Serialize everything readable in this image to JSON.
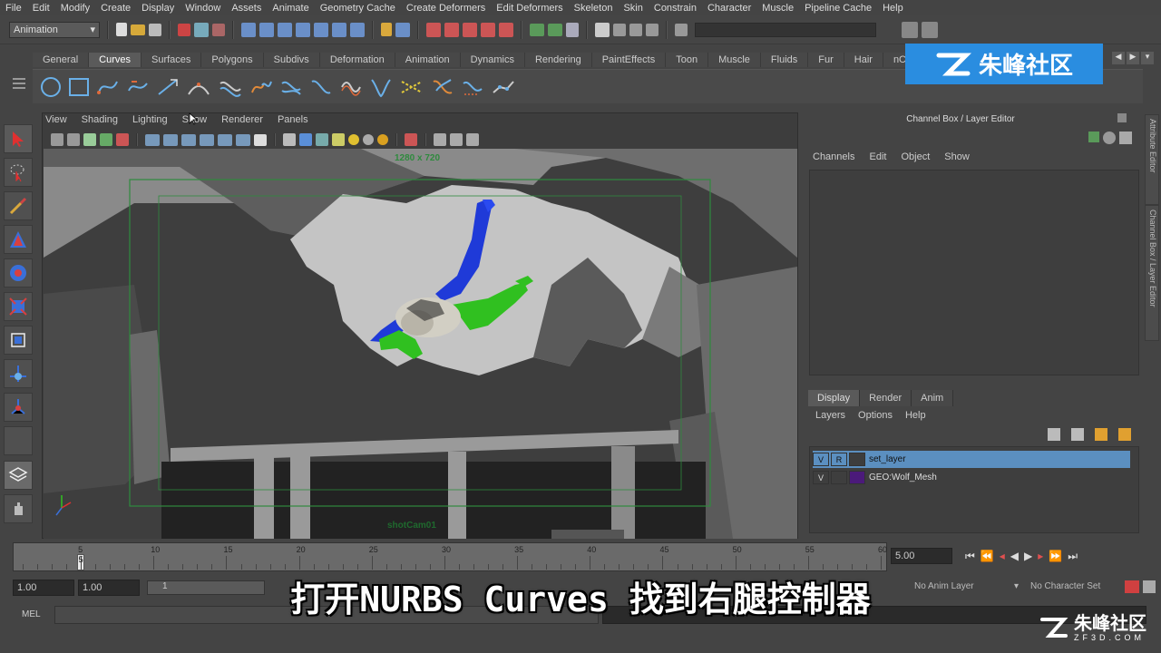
{
  "menu": [
    "File",
    "Edit",
    "Modify",
    "Create",
    "Display",
    "Window",
    "Assets",
    "Animate",
    "Geometry Cache",
    "Create Deformers",
    "Edit Deformers",
    "Skeleton",
    "Skin",
    "Constrain",
    "Character",
    "Muscle",
    "Pipeline Cache",
    "Help"
  ],
  "status_line": {
    "mode": "Animation"
  },
  "shelf_tabs": [
    {
      "label": "General",
      "active": false
    },
    {
      "label": "Curves",
      "active": true
    },
    {
      "label": "Surfaces",
      "active": false
    },
    {
      "label": "Polygons",
      "active": false
    },
    {
      "label": "Subdivs",
      "active": false
    },
    {
      "label": "Deformation",
      "active": false
    },
    {
      "label": "Animation",
      "active": false
    },
    {
      "label": "Dynamics",
      "active": false
    },
    {
      "label": "Rendering",
      "active": false
    },
    {
      "label": "PaintEffects",
      "active": false
    },
    {
      "label": "Toon",
      "active": false
    },
    {
      "label": "Muscle",
      "active": false
    },
    {
      "label": "Fluids",
      "active": false
    },
    {
      "label": "Fur",
      "active": false
    },
    {
      "label": "Hair",
      "active": false
    },
    {
      "label": "nClo",
      "active": false
    }
  ],
  "viewport": {
    "menu": [
      "View",
      "Shading",
      "Lighting",
      "Show",
      "Renderer",
      "Panels"
    ],
    "resolution_label": "1280 x 720",
    "camera_label": "shotCam01"
  },
  "channel_box": {
    "title": "Channel Box / Layer Editor",
    "menu": [
      "Channels",
      "Edit",
      "Object",
      "Show"
    ],
    "side_tabs": [
      "Attribute Editor",
      "Channel Box / Layer Editor"
    ]
  },
  "layer_editor": {
    "tabs": [
      "Display",
      "Render",
      "Anim"
    ],
    "menu": [
      "Layers",
      "Options",
      "Help"
    ],
    "layers": [
      {
        "v": "V",
        "r": "R",
        "name": "set_layer",
        "color": "#3d3d3d",
        "selected": true
      },
      {
        "v": "V",
        "r": "",
        "name": "GEO:Wolf_Mesh",
        "color": "#4b1a7a",
        "selected": false
      }
    ]
  },
  "timeline": {
    "ticks": [
      "5",
      "10",
      "15",
      "20",
      "25",
      "30",
      "35",
      "40",
      "45",
      "50",
      "55",
      "60"
    ],
    "current_frame_marker": "5",
    "current_time": "5.00"
  },
  "range": {
    "start": "1.00",
    "playback_start": "1.00",
    "slider_value": "1",
    "anim_layer": "No Anim Layer",
    "character_set": "No Character Set"
  },
  "command_line": {
    "label": "MEL"
  },
  "subtitle": "打开NURBS Curves 找到右腿控制器",
  "watermark": {
    "top": "朱峰社区",
    "bottom_name": "朱峰社区",
    "bottom_url": "ZF3D.COM"
  },
  "colors": {
    "accent_blue": "#5b8fc0",
    "watermark_blue": "#2a8de0",
    "camera_gate": "#2f8a3e"
  }
}
